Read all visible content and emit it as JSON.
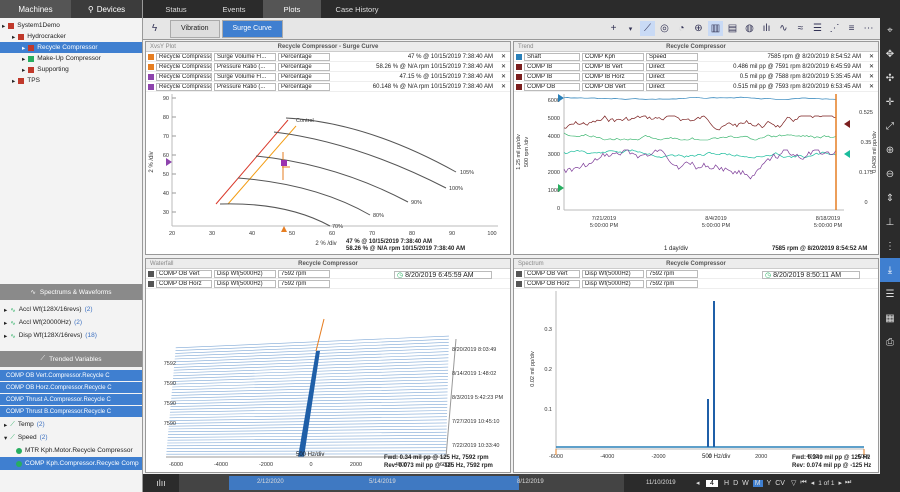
{
  "left": {
    "tabs": [
      "Machines",
      "Devices"
    ],
    "tree": [
      {
        "label": "System1Demo",
        "indent": 2,
        "color": "#c0392b",
        "sel": false
      },
      {
        "label": "Hydrocracker",
        "indent": 12,
        "color": "#c0392b",
        "sel": false
      },
      {
        "label": "Recycle Compressor",
        "indent": 22,
        "color": "#c0392b",
        "sel": true
      },
      {
        "label": "Make-Up Compressor",
        "indent": 22,
        "color": "#27ae60",
        "sel": false
      },
      {
        "label": "Supporting",
        "indent": 22,
        "color": "#c0392b",
        "sel": false
      },
      {
        "label": "TPS",
        "indent": 12,
        "color": "#c0392b",
        "sel": false
      }
    ],
    "spectrums_header": "Spectrums & Waveforms",
    "spectrums": [
      {
        "label": "Accl Wf(128X/16revs)",
        "count": "(2)"
      },
      {
        "label": "Accl Wf(20000Hz)",
        "count": "(2)"
      },
      {
        "label": "Disp Wf(128X/16revs)",
        "count": "(18)"
      }
    ],
    "trended_header": "Trended Variables",
    "trended_selected": [
      "COMP OB Vert.Compressor.Recycle C",
      "COMP OB Horz.Compressor.Recycle C",
      "COMP Thrust A.Compressor.Recycle C",
      "COMP Thrust B.Compressor.Recycle C"
    ],
    "temp": {
      "label": "Temp",
      "count": "(2)"
    },
    "speed": {
      "label": "Speed",
      "count": "(2)"
    },
    "speed_items": [
      "MTR Kph.Motor.Recycle Compressor",
      "COMP Kph.Compressor.Recycle Comp"
    ]
  },
  "top_tabs": [
    "Status",
    "Events",
    "Plots",
    "Case History"
  ],
  "sub_tabs": [
    "Vibration",
    "Surge Curve"
  ],
  "xvy": {
    "panel_label": "XvsY Plot",
    "title": "Recycle Compressor - Surge Curve",
    "rows": [
      {
        "a": "Recycle Compressor",
        "b": "Surge Volume Fl...",
        "c": "Percentage",
        "d": "47 % @ 10/15/2019 7:38:40 AM",
        "color": "#e67e22"
      },
      {
        "a": "Recycle Compressor",
        "b": "Pressure Ratio (...",
        "c": "Percentage",
        "d": "58.26 % @ N/A rpm 10/15/2019 7:38:40 AM",
        "color": "#e67e22"
      },
      {
        "a": "Recycle Compressor",
        "b": "Surge Volume Fl...",
        "c": "Percentage",
        "d": "47.15 % @ 10/15/2019 7:38:40 AM",
        "color": "#8e44ad"
      },
      {
        "a": "Recycle Compressor",
        "b": "Pressure Ratio (...",
        "c": "Percentage",
        "d": "60.148 % @ N/A rpm 10/15/2019 7:38:40 AM",
        "color": "#8e44ad"
      }
    ],
    "y_ticks": [
      "90",
      "80",
      "70",
      "60",
      "50",
      "40",
      "30"
    ],
    "x_ticks": [
      "20",
      "30",
      "40",
      "50",
      "60",
      "70",
      "80",
      "90",
      "100"
    ],
    "ylabel": "2 % /div",
    "xlabel": "2 % /div",
    "curves": [
      "105%",
      "100%",
      "90%",
      "80%",
      "70%"
    ],
    "control_label": "Control",
    "foot1": "47 % @ 10/15/2019 7:38:40 AM",
    "foot2": "58.26 % @ N/A rpm 10/15/2019 7:38:40 AM"
  },
  "trend": {
    "panel_label": "Trend",
    "title": "Recycle Compressor",
    "rows": [
      {
        "a": "Shaft",
        "b": "COMP Kph",
        "c": "Speed",
        "d": "7585 rpm @ 8/20/2019 8:54:52 AM",
        "color": "#2980b9"
      },
      {
        "a": "COMP IB",
        "b": "COMP IB Vert",
        "c": "Direct",
        "d": "0.486 mil pp @ 7591 rpm 8/20/2019 6:45:59 AM",
        "color": "#7b1f1f"
      },
      {
        "a": "COMP IB",
        "b": "COMP IB Horz",
        "c": "Direct",
        "d": "0.5 mil pp @ 7588 rpm 8/20/2019 5:35:45 AM",
        "color": "#7b1f1f"
      },
      {
        "a": "COMP OB",
        "b": "COMP OB Vert",
        "c": "Direct",
        "d": "0.515 mil pp @ 7593 rpm 8/20/2019 6:53:45 AM",
        "color": "#7b1f1f"
      }
    ],
    "y_ticks": [
      "6000",
      "5000",
      "4000",
      "3000",
      "2000",
      "1000",
      "0"
    ],
    "y2_ticks": [
      "0.525",
      "0.35",
      "0.175",
      "0"
    ],
    "ylabel_a": "1.25 mil pp/div",
    "ylabel_b": "500 rpm /div",
    "ylabel_r": "0.0438 mil pp/div",
    "x_ticks": [
      "7/21/2019 5:00:00 PM",
      "8/4/2019 5:00:00 PM",
      "8/18/2019 5:00:00 PM"
    ],
    "xlabel": "1 day/div",
    "foot": "7585 rpm @ 8/20/2019 8:54:52 AM"
  },
  "waterfall": {
    "panel_label": "Waterfall",
    "title": "Recycle Compressor",
    "rows": [
      {
        "a": "COMP OB Vert",
        "b": "Disp Wf(5000Hz)",
        "c": "7592 rpm"
      },
      {
        "a": "COMP OB Horz",
        "b": "Disp Wf(5000Hz)",
        "c": "7592 rpm"
      }
    ],
    "date_sel": "8/20/2019 6:45:59 AM",
    "y_ticks": [
      "7592",
      "7590",
      "7590",
      "7590"
    ],
    "x_ticks": [
      "-6000",
      "-4000",
      "-2000",
      "0",
      "2000",
      "4000",
      "6000"
    ],
    "xlabel": "500 Hz/div",
    "dates": [
      "8/20/2019 8:03:49",
      "8/14/2019 1:48:02",
      "8/3/2019 5:42:23 PM",
      "7/27/2019 10:45:10",
      "7/22/2019 10:33:40"
    ],
    "foot1": "Fwd: 0.34 mil pp @ 125 Hz, 7592 rpm",
    "foot2": "Rev: 0.073 mil pp @ -125 Hz, 7592 rpm"
  },
  "spectrum": {
    "panel_label": "Spectrum",
    "title": "Recycle Compressor",
    "rows": [
      {
        "a": "COMP OB Vert",
        "b": "Disp Wf(5000Hz)",
        "c": "7592 rpm"
      },
      {
        "a": "COMP OB Horz",
        "b": "Disp Wf(5000Hz)",
        "c": "7592 rpm"
      }
    ],
    "date_sel": "8/20/2019 8:50:11 AM",
    "y_ticks": [
      "0.3",
      "0.2",
      "0.1"
    ],
    "ylabel": "0.02 mil pp/div",
    "x_ticks": [
      "-6000",
      "-4000",
      "-2000",
      "0",
      "2000",
      "4000",
      "6000"
    ],
    "xlabel": "500 Hz/div",
    "foot1": "Fwd: 0.349 mil pp @ 125 Hz",
    "foot2": "Rev: 0.074 mil pp @ -125 Hz"
  },
  "bottom": {
    "dates": [
      "2/12/2020",
      "5/14/2019",
      "8/12/2019",
      "11/10/2019"
    ],
    "count": "4",
    "zoom": [
      "H",
      "D",
      "W",
      "M",
      "Y",
      "CV"
    ],
    "page": "1 of 1"
  }
}
